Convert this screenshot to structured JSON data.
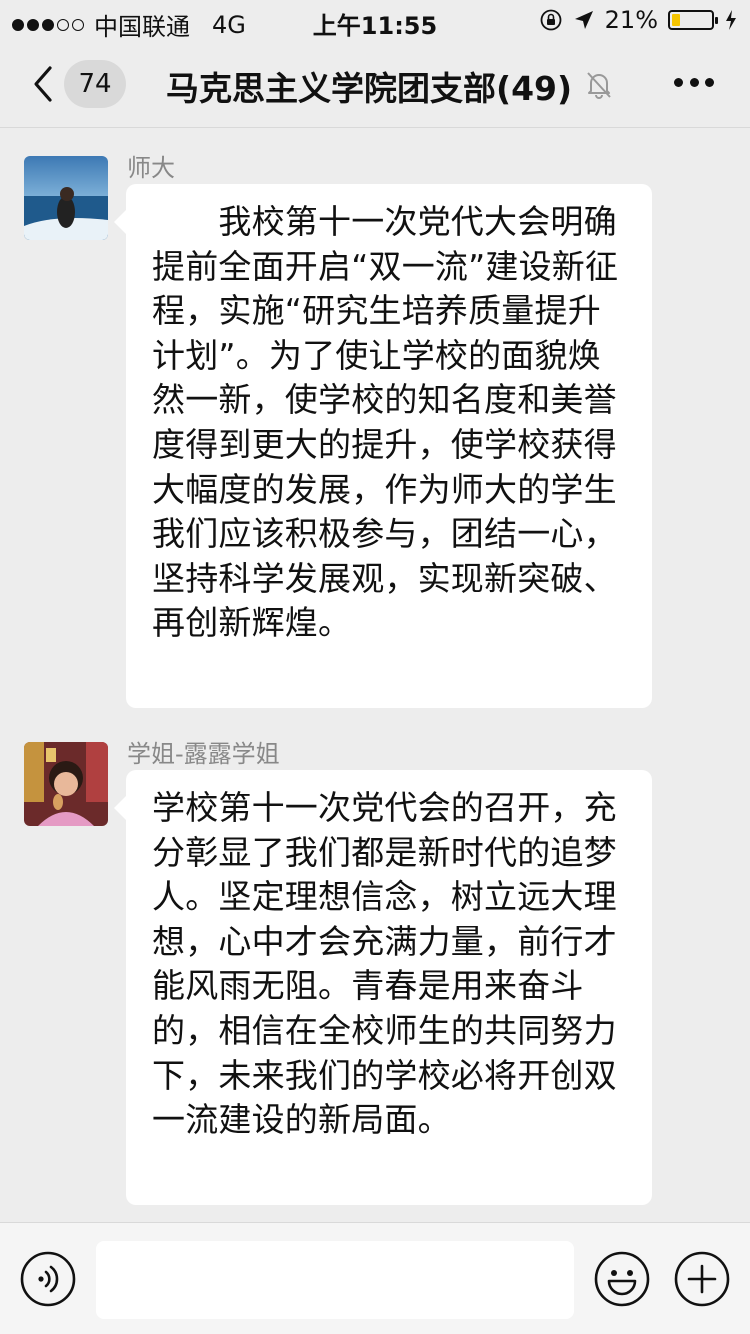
{
  "status_bar": {
    "carrier": "中国联通",
    "network": "4G",
    "time": "上午11:55",
    "battery_percent": "21%",
    "battery_level": 0.21
  },
  "nav": {
    "unread_count": "74",
    "title": "马克思主义学院团支部(49)"
  },
  "messages": [
    {
      "sender": "师大",
      "text": "　　我校第十一次党代大会明确提前全面开启“双一流”建设新征程，实施“研究生培养质量提升计划”。为了使让学校的面貌焕然一新，使学校的知名度和美誉度得到更大的提升，使学校获得大幅度的发展，作为师大的学生我们应该积极参与，团结一心，坚持科学发展观，实现新突破、再创新辉煌。"
    },
    {
      "sender": "学姐-露露学姐",
      "text": "学校第十一次党代会的召开，充分彰显了我们都是新时代的追梦人。坚定理想信念，树立远大理想，心中才会充满力量，前行才能风雨无阻。青春是用来奋斗的，相信在全校师生的共同努力下，未来我们的学校必将开创双一流建设的新局面。"
    }
  ],
  "input": {
    "value": "",
    "placeholder": ""
  },
  "colors": {
    "background": "#ededed",
    "bubble": "#ffffff",
    "battery_fill": "#f5c400"
  },
  "icons": [
    "back-chevron-icon",
    "bell-muted-icon",
    "more-icon",
    "voice-icon",
    "emoji-icon",
    "plus-icon"
  ]
}
